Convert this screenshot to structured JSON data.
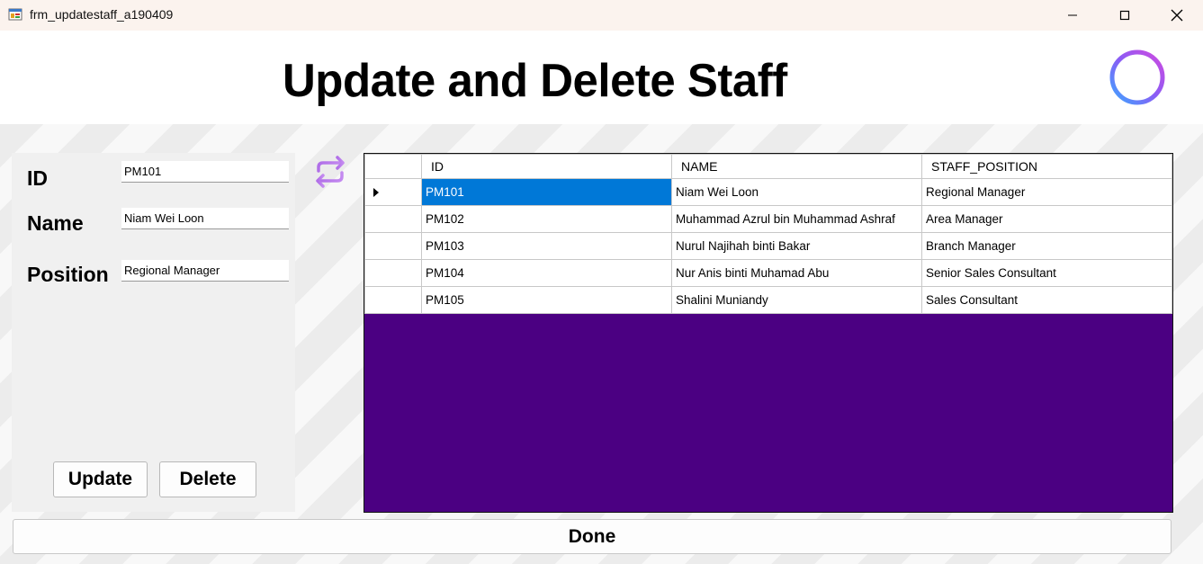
{
  "window": {
    "title": "frm_updatestaff_a190409",
    "minimize_icon": "minimize-icon",
    "maximize_icon": "maximize-icon",
    "close_icon": "close-icon"
  },
  "header": {
    "title": "Update and Delete Staff",
    "add_icon": "plus-circle-icon"
  },
  "form": {
    "id_label": "ID",
    "id_value": "PM101",
    "name_label": "Name",
    "name_value": "Niam Wei Loon",
    "position_label": "Position",
    "position_value": "Regional Manager",
    "update_label": "Update",
    "delete_label": "Delete"
  },
  "refresh_icon": "refresh-arrows-icon",
  "grid": {
    "columns": [
      "ID",
      "NAME",
      "STAFF_POSITION"
    ],
    "rows": [
      {
        "id": "PM101",
        "name": "Niam Wei Loon",
        "position": "Regional Manager"
      },
      {
        "id": "PM102",
        "name": "Muhammad Azrul bin Muhammad Ashraf",
        "position": "Area Manager"
      },
      {
        "id": "PM103",
        "name": "Nurul Najihah binti Bakar",
        "position": "Branch Manager"
      },
      {
        "id": "PM104",
        "name": "Nur Anis binti Muhamad Abu",
        "position": "Senior Sales Consultant"
      },
      {
        "id": "PM105",
        "name": "Shalini Muniandy",
        "position": "Sales Consultant"
      }
    ],
    "background_color": "#4b0082",
    "selection_color": "#0078d7"
  },
  "done_label": "Done"
}
